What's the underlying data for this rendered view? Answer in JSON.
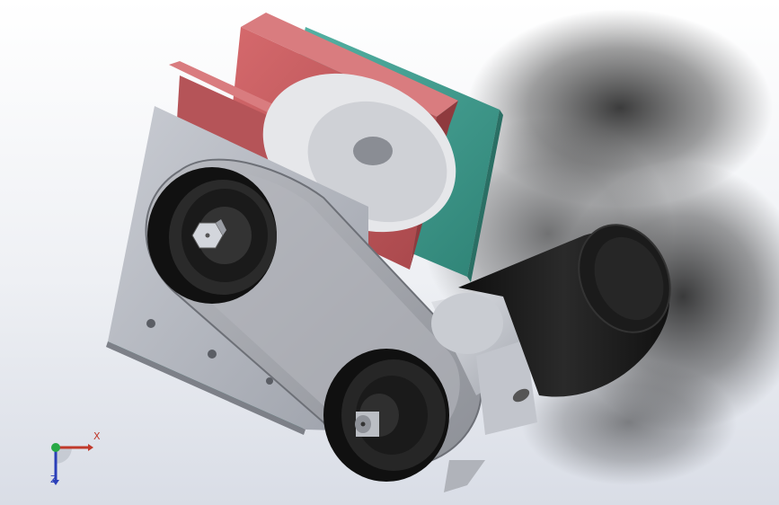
{
  "viewport": {
    "background_top": "#ffffff",
    "background_bottom": "#d9dde6"
  },
  "model": {
    "parts": [
      {
        "name": "side-plate",
        "color": "#b3b7c0"
      },
      {
        "name": "teal-plate",
        "color": "#3e9e91"
      },
      {
        "name": "red-bracket",
        "color": "#c4565a"
      },
      {
        "name": "upper-pulley",
        "color": "#1e1e1e"
      },
      {
        "name": "lower-pulley",
        "color": "#1e1e1e"
      },
      {
        "name": "belt",
        "color": "#a6a8ae"
      },
      {
        "name": "motor-body",
        "color": "#1c1c1c"
      },
      {
        "name": "gearbox",
        "color": "#c2c5cc"
      },
      {
        "name": "hex-bolt",
        "color": "#cfd2d8"
      }
    ]
  },
  "triad": {
    "x_label": "X",
    "z_label": "Z",
    "x_color": "#c0392b",
    "y_color": "#27a845",
    "z_color": "#2a3fb8"
  }
}
